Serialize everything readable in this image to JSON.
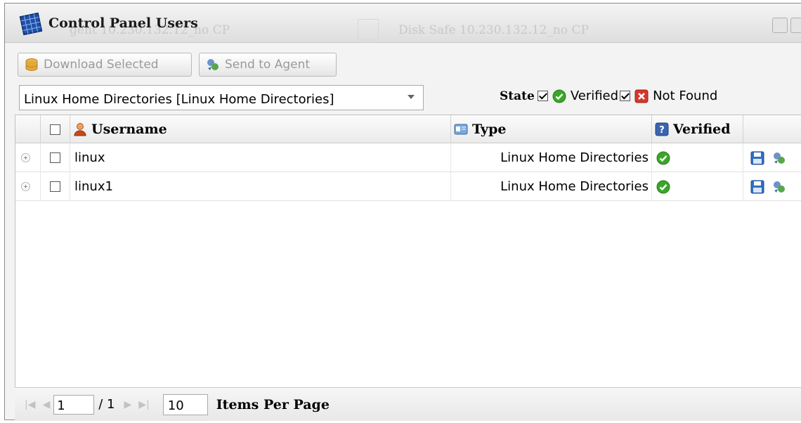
{
  "window": {
    "title": "Control Panel Users",
    "background_left": "gent 10.230.132.12_no CP",
    "background_right": "Disk Safe 10.230.132.12_no CP"
  },
  "toolbar": {
    "download_label": "Download Selected",
    "send_label": "Send to Agent"
  },
  "filter": {
    "selected": "Linux Home Directories [Linux Home Directories]",
    "state_label": "State",
    "verified_label": "Verified",
    "verified_checked": true,
    "not_found_label": "Not Found",
    "not_found_checked": true
  },
  "grid": {
    "columns": {
      "username": "Username",
      "type": "Type",
      "verified": "Verified"
    },
    "rows": [
      {
        "username": "linux",
        "type": "Linux Home Directories",
        "verified": true
      },
      {
        "username": "linux1",
        "type": "Linux Home Directories",
        "verified": true
      }
    ]
  },
  "pager": {
    "page": "1",
    "total": "/ 1",
    "items_per_page": "10",
    "items_per_page_label": "Items Per Page"
  },
  "colors": {
    "verified_green": "#3aa629",
    "not_found_red": "#d7362b",
    "save_blue": "#2f6fc1"
  }
}
